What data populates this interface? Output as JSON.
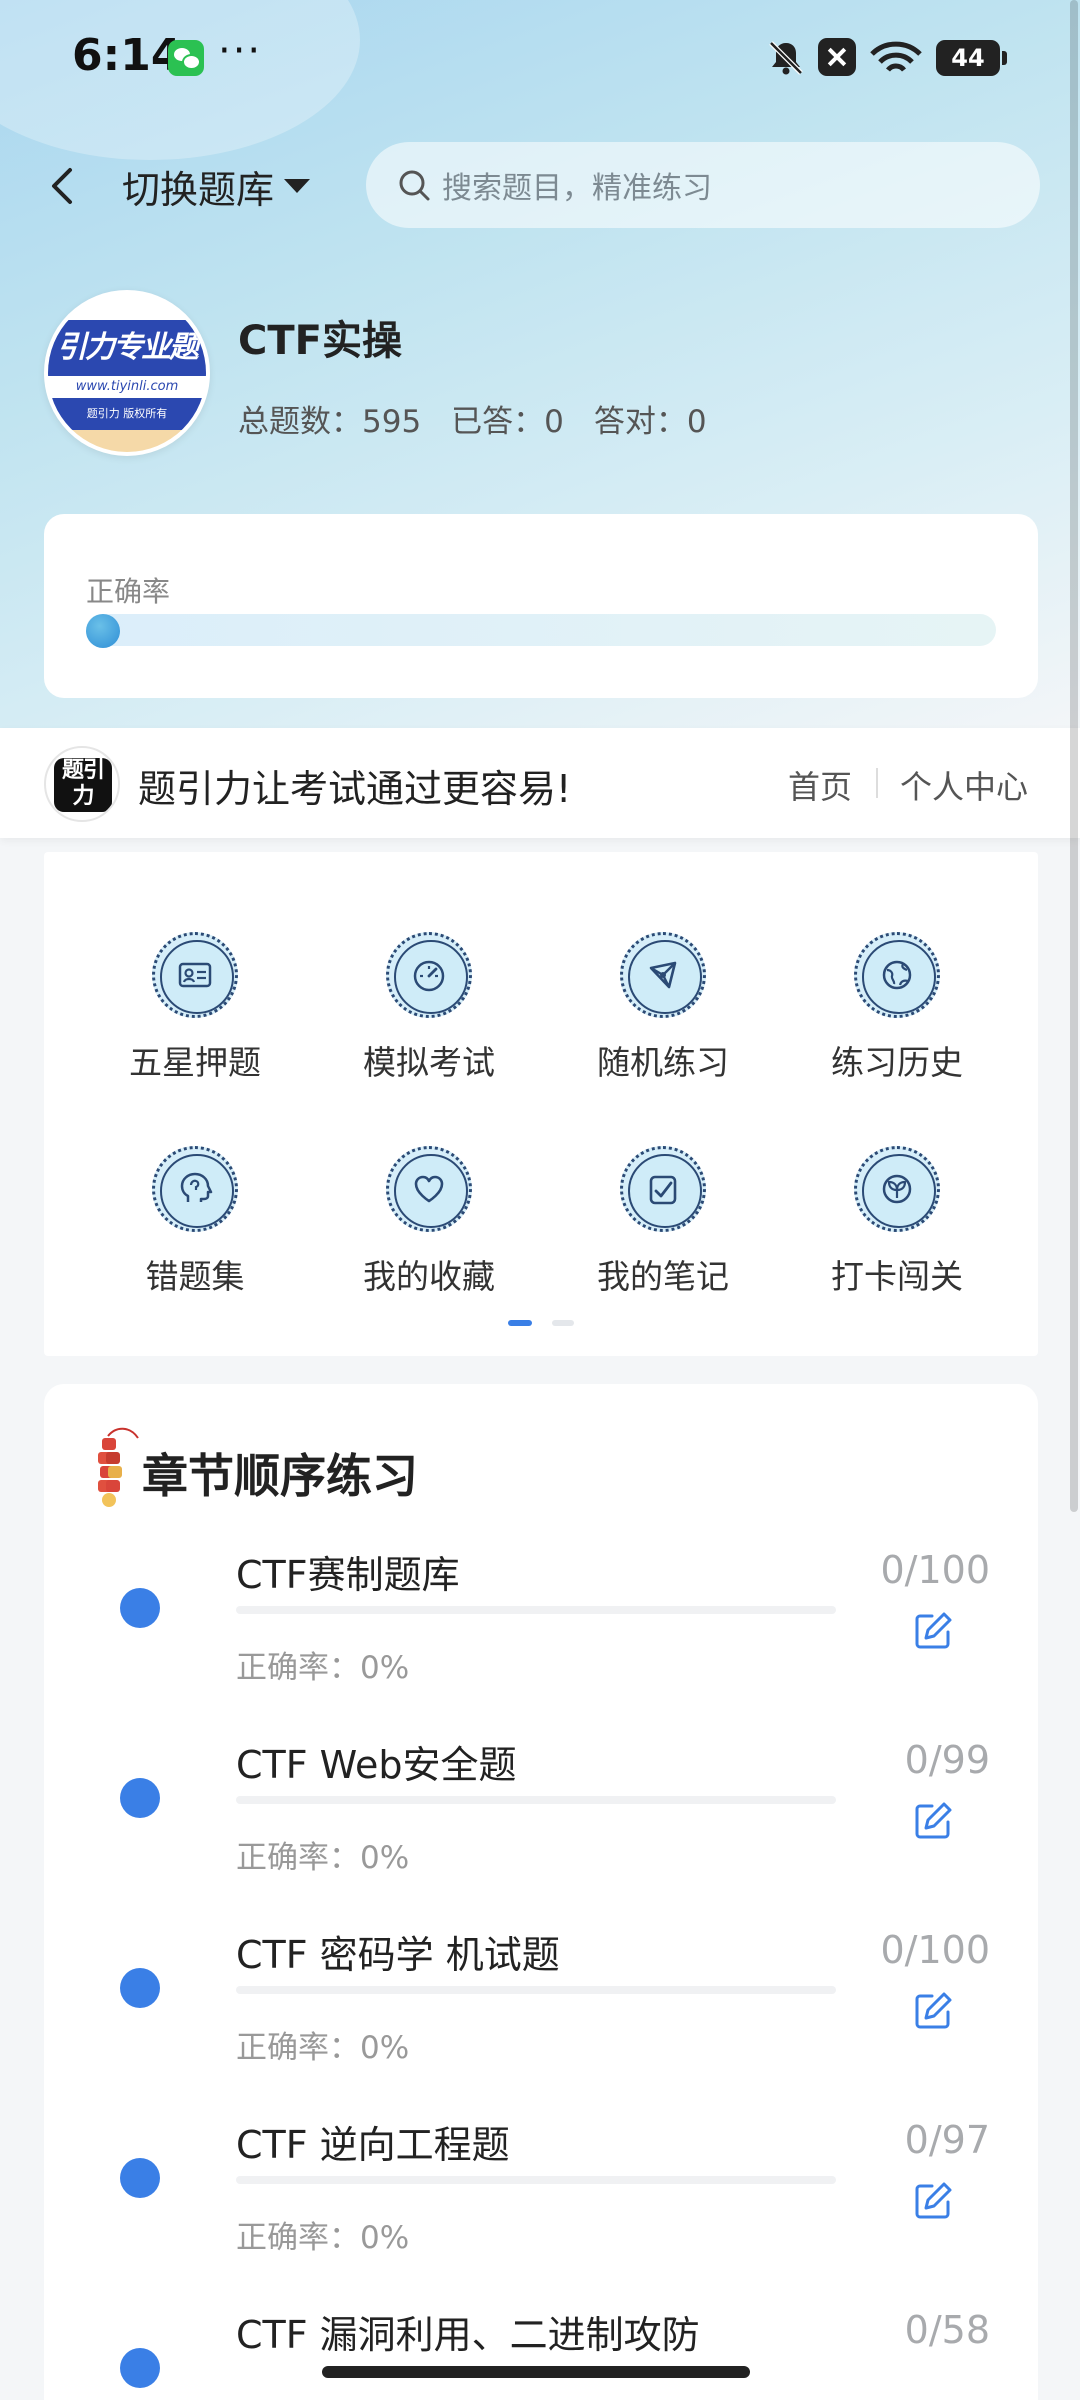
{
  "status_bar": {
    "time": "6:14",
    "more": "···",
    "battery": "44"
  },
  "nav": {
    "switch_bank_label": "切换题库",
    "search_placeholder": "搜索题目，精准练习"
  },
  "bank": {
    "logo_text_main": "引力专业题",
    "logo_url": "www.tiyinli.com",
    "logo_footer": "题引力 版权所有",
    "name": "CTF实操",
    "total_label": "总题数：595",
    "answered_label": "已答：0",
    "correct_label": "答对：0"
  },
  "accuracy": {
    "label": "正确率",
    "value_fraction": 0
  },
  "brand_bar": {
    "logo_text": "题引力",
    "slogan": "题引力让考试通过更容易!",
    "home_link": "首页",
    "profile_link": "个人中心"
  },
  "tools": [
    {
      "label": "五星押题",
      "icon": "id-card-icon"
    },
    {
      "label": "模拟考试",
      "icon": "gauge-icon"
    },
    {
      "label": "随机练习",
      "icon": "network-icon"
    },
    {
      "label": "练习历史",
      "icon": "globe-icon"
    },
    {
      "label": "错题集",
      "icon": "head-icon"
    },
    {
      "label": "我的收藏",
      "icon": "heart-icon"
    },
    {
      "label": "我的笔记",
      "icon": "note-check-icon"
    },
    {
      "label": "打卡闯关",
      "icon": "leaf-icon"
    }
  ],
  "pager": {
    "active_page": 1,
    "total_pages": 2
  },
  "chapters": {
    "title": "章节顺序练习",
    "items": [
      {
        "name": "CTF赛制题库",
        "accuracy": "正确率：0%",
        "count": "0/100"
      },
      {
        "name": "CTF Web安全题",
        "accuracy": "正确率：0%",
        "count": "0/99"
      },
      {
        "name": "CTF 密码学 机试题",
        "accuracy": "正确率：0%",
        "count": "0/100"
      },
      {
        "name": "CTF 逆向工程题",
        "accuracy": "正确率：0%",
        "count": "0/97"
      },
      {
        "name": "CTF 漏洞利用、二进制攻防",
        "accuracy": "",
        "count": "0/58"
      }
    ]
  },
  "colors": {
    "accent": "#3a7fe6",
    "icon_stroke": "#2b4a75",
    "icon_fill": "#d6eef9"
  }
}
